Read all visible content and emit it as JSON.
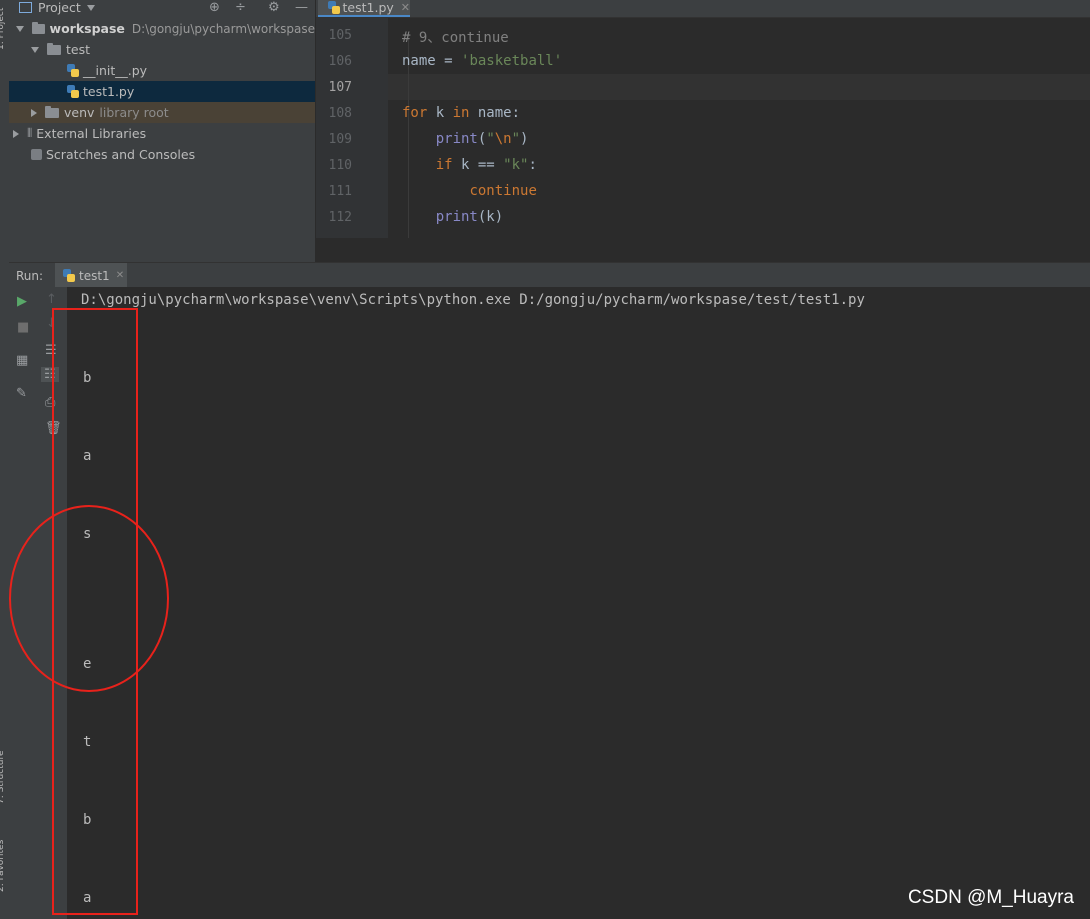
{
  "left_strip": {
    "top_label": "1: Project",
    "structure_label": "7: Structure",
    "favorites_label": "2: Favorites"
  },
  "project": {
    "header_title": "Project",
    "tree": [
      {
        "name": "workspase",
        "path": "D:\\gongju\\pycharm\\workspase"
      },
      {
        "name": "test"
      },
      {
        "name": "__init__.py"
      },
      {
        "name": "test1.py"
      },
      {
        "name": "venv",
        "hint": "library root"
      },
      {
        "name": "External Libraries"
      },
      {
        "name": "Scratches and Consoles"
      }
    ]
  },
  "editor": {
    "tab_label": "test1.py",
    "lines": [
      {
        "num": "105",
        "text": "# 9、continue"
      },
      {
        "num": "106",
        "text": "name = 'basketball'"
      },
      {
        "num": "107",
        "text": ""
      },
      {
        "num": "108",
        "text": "for k in name:"
      },
      {
        "num": "109",
        "text": "    print(\"\\n\")"
      },
      {
        "num": "110",
        "text": "    if k == \"k\":"
      },
      {
        "num": "111",
        "text": "        continue"
      },
      {
        "num": "112",
        "text": "    print(k)"
      }
    ]
  },
  "run": {
    "label": "Run:",
    "tab_label": "test1",
    "command": "D:\\gongju\\pycharm\\workspase\\venv\\Scripts\\python.exe D:/gongju/pycharm/workspase/test/test1.py",
    "output": [
      "b",
      "a",
      "s",
      "e",
      "t",
      "b",
      "a"
    ]
  },
  "watermark": "CSDN @M_Huayra",
  "colors": {
    "annotation": "#e8221b",
    "keyword": "#cc7832",
    "string": "#6a8759",
    "comment": "#808080",
    "builtin": "#8888c6"
  }
}
